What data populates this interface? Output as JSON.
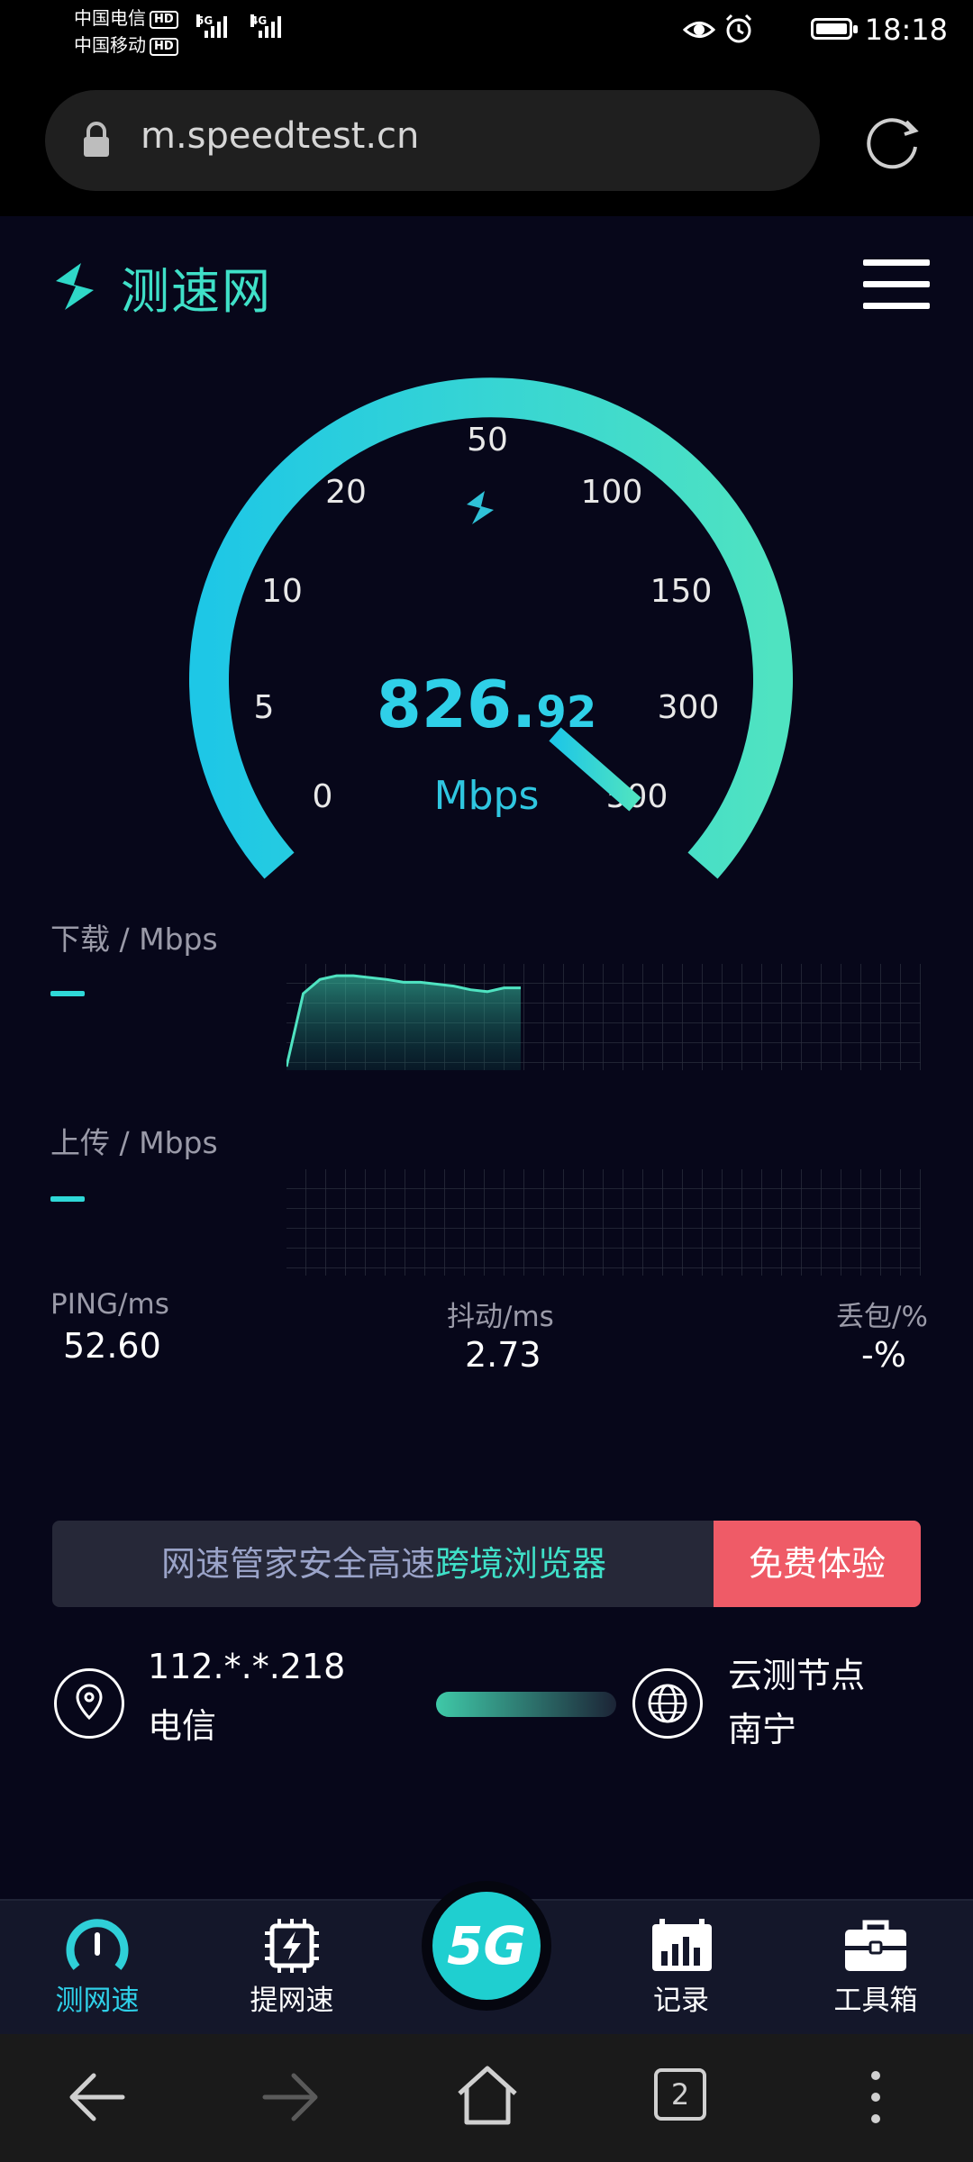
{
  "status_bar": {
    "carrier_1": "中国电信",
    "carrier_2": "中国移动",
    "hd_label": "HD",
    "net_5g": "5G",
    "net_4g": "4G",
    "time": "18:18"
  },
  "browser": {
    "url": "m.speedtest.cn"
  },
  "header": {
    "site_name": "测速网"
  },
  "gauge": {
    "ticks": [
      "0",
      "5",
      "10",
      "20",
      "50",
      "100",
      "150",
      "300",
      "500"
    ],
    "speed_integer": "826.",
    "speed_decimal": "92",
    "unit": "Mbps",
    "needle_value": 500,
    "colors": {
      "arc_start": "#1ec7e6",
      "arc_end": "#4fe3c1"
    }
  },
  "download": {
    "label": "下载 / Mbps",
    "value_placeholder": "—",
    "curve": [
      0.0,
      0.78,
      0.93,
      0.97,
      0.97,
      0.95,
      0.93,
      0.9,
      0.9,
      0.88,
      0.86,
      0.82,
      0.8,
      0.84,
      0.84
    ]
  },
  "upload": {
    "label": "上传 / Mbps",
    "value_placeholder": "—"
  },
  "stats": {
    "ping_label": "PING/ms",
    "ping_value": "52.60",
    "jitter_label": "抖动/ms",
    "jitter_value": "2.73",
    "loss_label": "丢包/%",
    "loss_value": "-%"
  },
  "banner": {
    "text_plain": "网速管家安全高速",
    "text_highlight": "跨境浏览器",
    "button": "免费体验"
  },
  "client": {
    "ip": "112.*.*.218",
    "isp": "电信"
  },
  "server": {
    "title": "云测节点",
    "city": "南宁"
  },
  "bottom_nav": {
    "items": [
      {
        "label": "测网速",
        "icon": "speedometer-icon",
        "active": true
      },
      {
        "label": "提网速",
        "icon": "chip-bolt-icon"
      },
      {
        "label": "5G",
        "icon": "5g-icon"
      },
      {
        "label": "记录",
        "icon": "bar-chart-icon"
      },
      {
        "label": "工具箱",
        "icon": "toolbox-icon"
      }
    ]
  },
  "system_nav": {
    "tab_count": "2"
  }
}
